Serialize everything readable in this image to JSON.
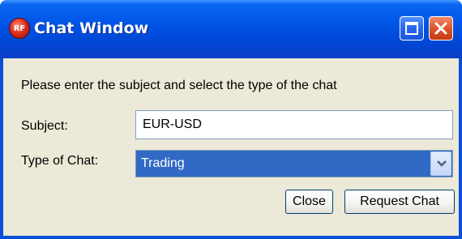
{
  "window": {
    "title": "Chat Window",
    "app_icon_text": "RF",
    "controls": [
      "maximize-icon",
      "close-icon"
    ]
  },
  "form": {
    "instruction": "Please enter the subject and select the type of the chat",
    "subject_label": "Subject:",
    "subject_value": "EUR-USD",
    "type_label": "Type of Chat:",
    "type_selected": "Trading"
  },
  "buttons": {
    "close_label": "Close",
    "request_label": "Request Chat"
  },
  "colors": {
    "titlebar": "#0055e5",
    "window_bg": "#ece9d8",
    "selection": "#316ac5"
  }
}
